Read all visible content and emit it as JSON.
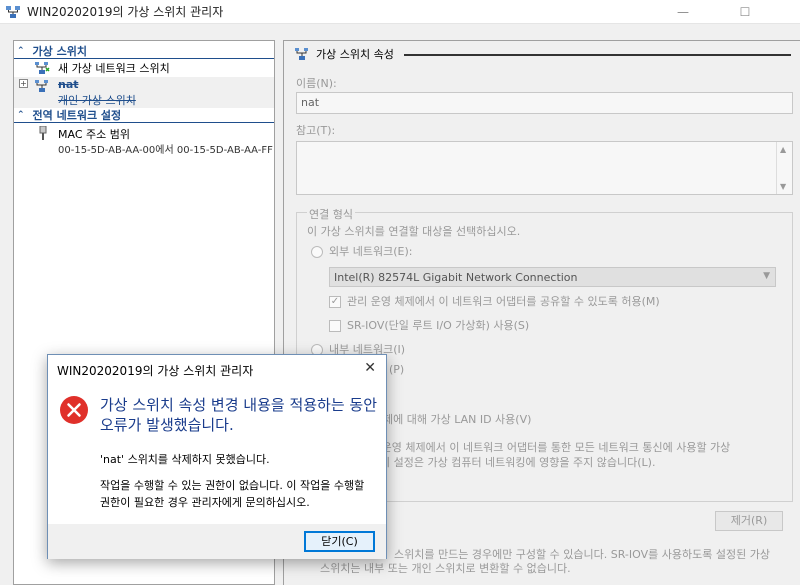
{
  "window": {
    "title": "WIN20202019의 가상 스위치 관리자",
    "minimize_glyph": "—",
    "maximize_glyph": "☐"
  },
  "left": {
    "section1": {
      "label": "가상 스위치",
      "chevron": "⌃"
    },
    "new_switch": "새 가상 네트워크 스위치",
    "nat": {
      "name": "nat",
      "type": "개인 가상 스위치",
      "expander": "+"
    },
    "section2": {
      "label": "전역 네트워크 설정",
      "chevron": "⌃"
    },
    "mac": {
      "label": "MAC 주소 범위",
      "range": "00-15-5D-AB-AA-00에서 00-15-5D-AB-AA-FF"
    }
  },
  "right": {
    "panel_title": "가상 스위치 속성",
    "name_label": "이름(N):",
    "name_value": "nat",
    "notes_label": "참고(T):",
    "conn_legend": "연결 형식",
    "conn_desc": "이 가상 스위치를 연결할 대상을 선택하십시오.",
    "external_label": "외부 네트워크(E):",
    "adapter": "Intel(R) 82574L Gigabit Network Connection",
    "share_label": "관리 운영 체제에서 이 네트워크 어댑터를 공유할 수 있도록 허용(M)",
    "sriov_label": "SR-IOV(단일 루트 I/O 가상화) 사용(S)",
    "internal_label": "내부 네트워크(I)",
    "private_label": "개인 네트워크(P)",
    "private_visible": "(P)",
    "vlan_label": "제에 대해 가상 LAN ID 사용(V)",
    "vlan_desc1": "리 운영 체제에서 이 네트워크 어댑터를 통한 모든 네트워크 통신에 사용할 가상",
    "vlan_desc2": ". 이 설정은 가상 컴퓨터 네트워킹에 영향을 주지 않습니다(L).",
    "remove_button": "제거(R)",
    "footer1": "스위치를 만드는 경우에만 구성할 수 있습니다. SR-IOV를 사용하도록 설정된 가상",
    "footer2": "스위치는 내부 또는 개인 스위치로 변환할 수 없습니다."
  },
  "dialog": {
    "title": "WIN20202019의 가상 스위치 관리자",
    "close_glyph": "✕",
    "main_message": "가상 스위치 속성 변경 내용을 적용하는 동안 오류가 발생했습니다.",
    "message1": "'nat' 스위치를 삭제하지 못했습니다.",
    "message2": "작업을 수행할 수 있는 권한이 없습니다. 이 작업을 수행할 권한이 필요한 경우 관리자에게 문의하십시오.",
    "close_button": "닫기(C)"
  },
  "colors": {
    "accent": "#1f4e8c",
    "error_red": "#e0302a",
    "button_border": "#0078d7"
  }
}
